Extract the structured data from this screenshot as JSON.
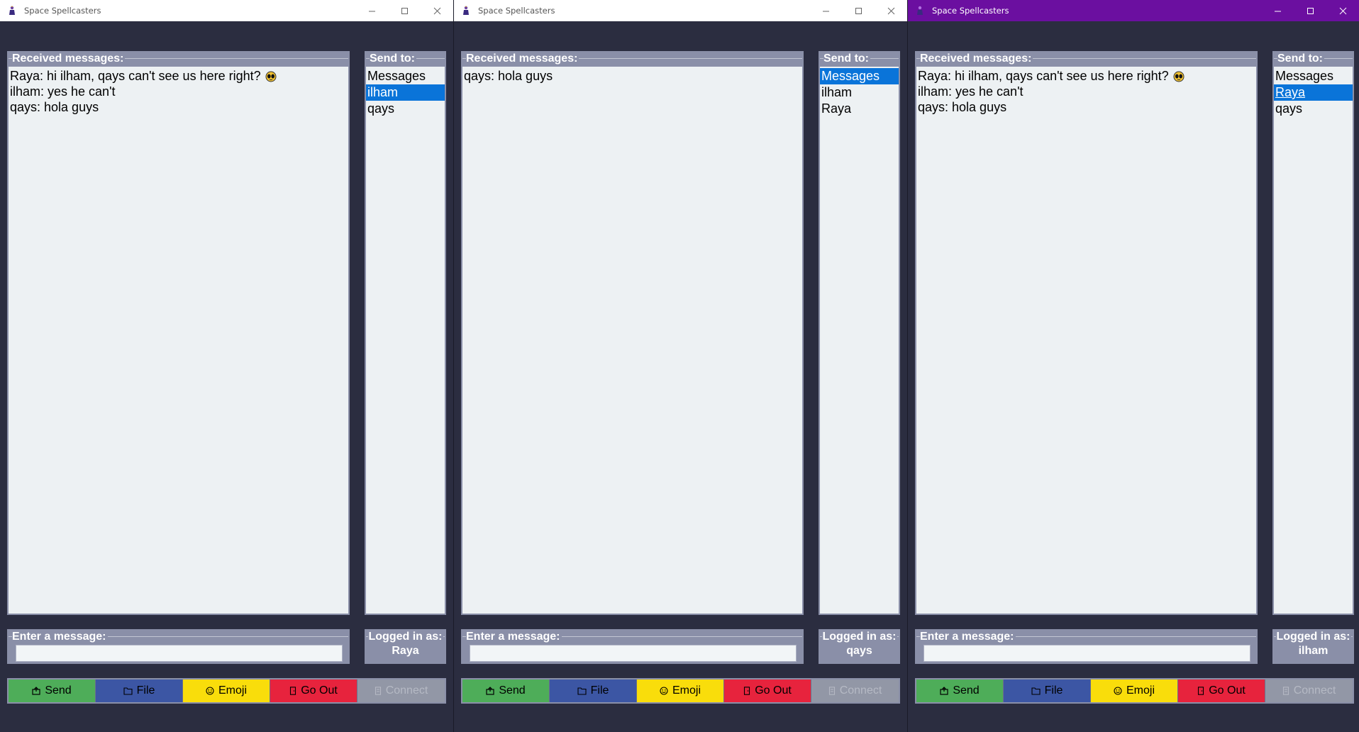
{
  "colors": {
    "background": "#2b2d40",
    "panel_border": "#8a8fa8",
    "active_titlebar": "#6b0fa0",
    "selection": "#0a74d9",
    "send": "#4ead59",
    "file": "#3c56a4",
    "emoji": "#f9dd0b",
    "go_out": "#e7233d",
    "connect_disabled": "#9297a6"
  },
  "windows": [
    {
      "title": "Space Spellcasters",
      "received_label": "Received messages:",
      "messages": [
        {
          "text": "Raya: hi ilham, qays can't see us here right?",
          "emoji": "alien-face-icon"
        },
        {
          "text": "ilham: yes he can't"
        },
        {
          "text": "qays: hola guys"
        }
      ],
      "send_to_label": "Send to:",
      "recipients": [
        {
          "label": "Messages",
          "selected": false
        },
        {
          "label": "ilham",
          "selected": true
        },
        {
          "label": "qays",
          "selected": false
        }
      ],
      "enter_label": "Enter a message:",
      "message_value": "",
      "logged_label": "Logged in as:",
      "user": "Raya",
      "buttons": {
        "send": "Send",
        "file": "File",
        "emoji": "Emoji",
        "go_out": "Go Out",
        "connect": "Connect"
      }
    },
    {
      "title": "Space Spellcasters",
      "received_label": "Received messages:",
      "messages": [
        {
          "text": "qays: hola guys"
        }
      ],
      "send_to_label": "Send to:",
      "recipients": [
        {
          "label": "Messages",
          "selected": true
        },
        {
          "label": "ilham",
          "selected": false
        },
        {
          "label": "Raya",
          "selected": false
        }
      ],
      "enter_label": "Enter a message:",
      "message_value": "",
      "logged_label": "Logged in as:",
      "user": "qays",
      "buttons": {
        "send": "Send",
        "file": "File",
        "emoji": "Emoji",
        "go_out": "Go Out",
        "connect": "Connect"
      }
    },
    {
      "title": "Space Spellcasters",
      "active": true,
      "received_label": "Received messages:",
      "messages": [
        {
          "text": "Raya: hi ilham, qays can't see us here right?",
          "emoji": "alien-face-icon"
        },
        {
          "text": "ilham: yes he can't"
        },
        {
          "text": "qays: hola guys"
        }
      ],
      "send_to_label": "Send to:",
      "recipients": [
        {
          "label": "Messages",
          "selected": false
        },
        {
          "label": "Raya",
          "selected": true,
          "underlined": true
        },
        {
          "label": "qays",
          "selected": false
        }
      ],
      "enter_label": "Enter a message:",
      "message_value": "",
      "logged_label": "Logged in as:",
      "user": "ilham",
      "buttons": {
        "send": "Send",
        "file": "File",
        "emoji": "Emoji",
        "go_out": "Go Out",
        "connect": "Connect"
      }
    }
  ]
}
